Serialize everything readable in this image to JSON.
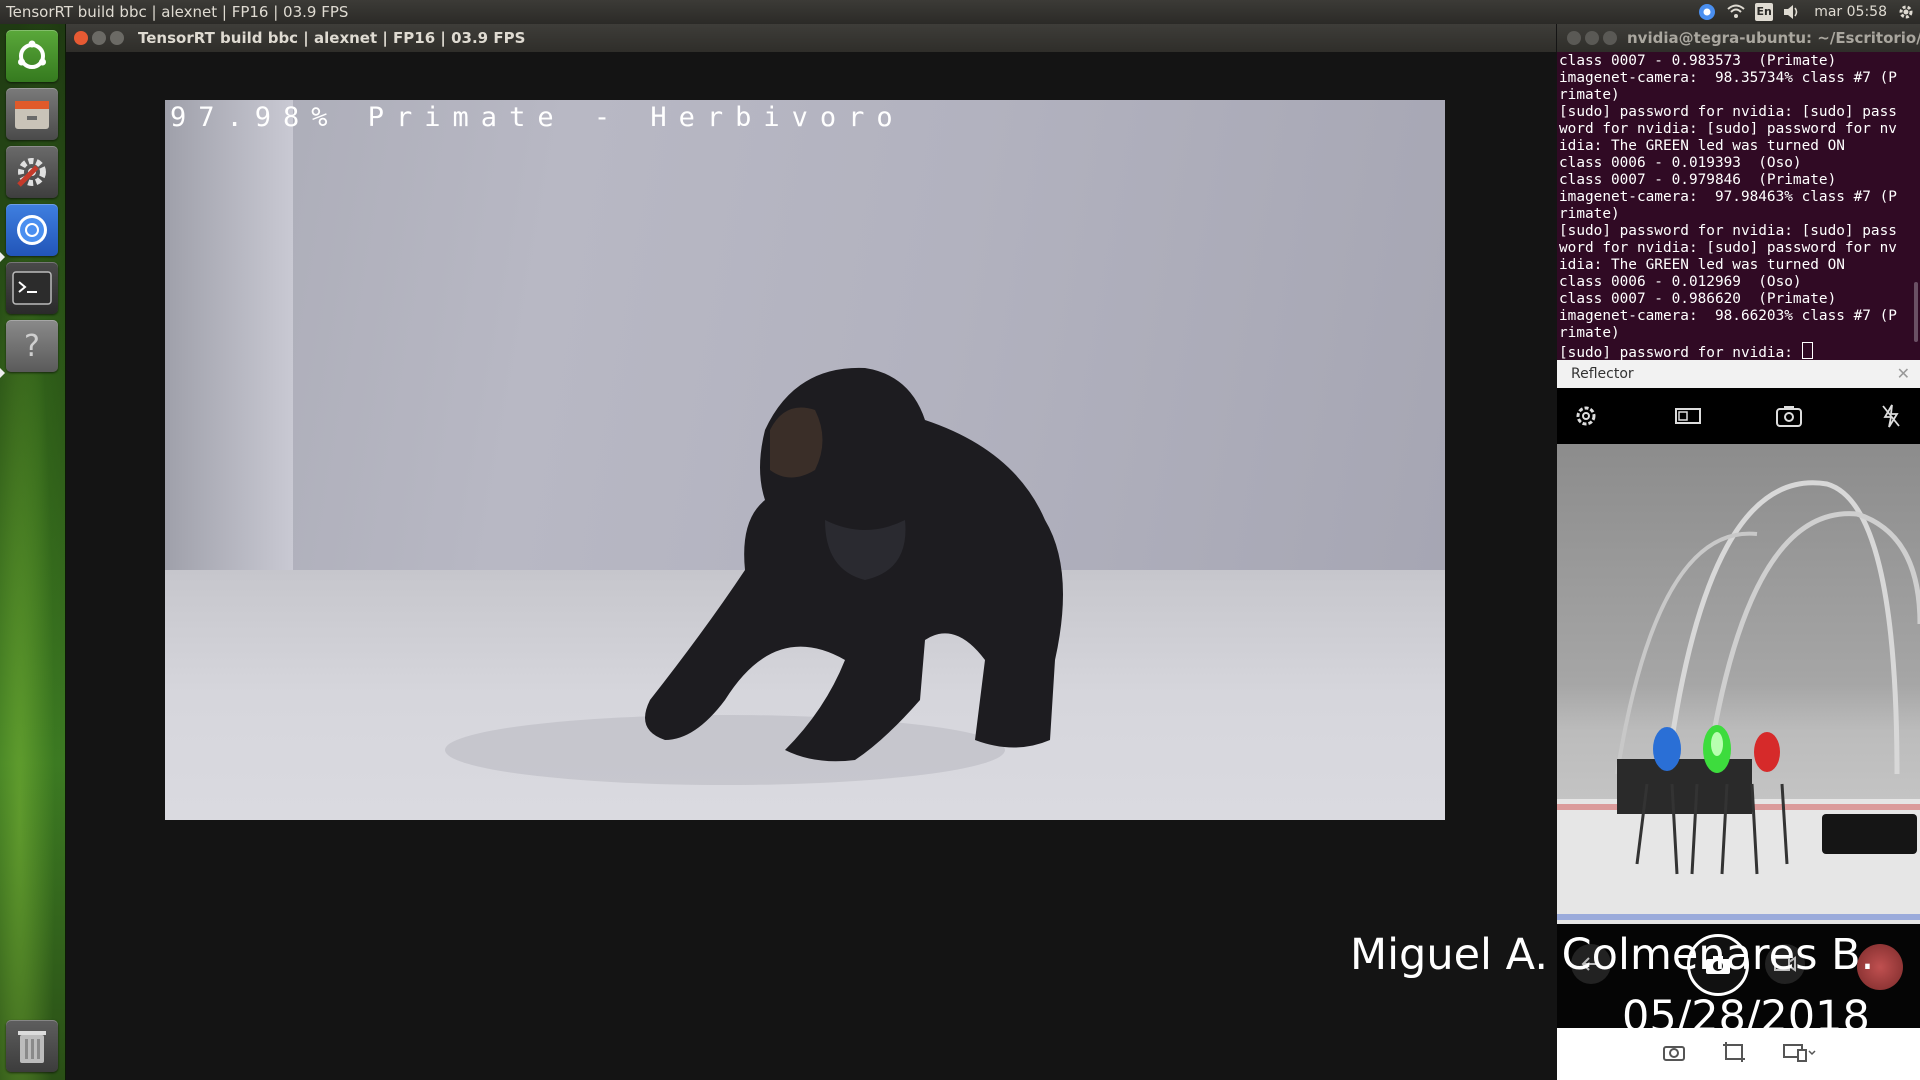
{
  "top_panel": {
    "title": "TensorRT build bbc | alexnet | FP16 | 03.9 FPS",
    "language": "En",
    "clock": "mar 05:58"
  },
  "launcher": {
    "items": [
      {
        "icon": "ubuntu-dash-icon"
      },
      {
        "icon": "file-manager-icon"
      },
      {
        "icon": "system-settings-icon"
      },
      {
        "icon": "chromium-icon"
      },
      {
        "icon": "terminal-icon"
      },
      {
        "icon": "help-icon"
      },
      {
        "icon": "trash-icon"
      }
    ]
  },
  "main_window": {
    "title": "TensorRT build bbc | alexnet | FP16 | 03.9 FPS",
    "overlay_label": "97.98% Primate - Herbivoro"
  },
  "terminal": {
    "title": "nvidia@tegra-ubuntu: ~/Escritorio/jetson",
    "lines": [
      "class 0007 - 0.983573  (Primate)",
      "imagenet-camera:  98.35734% class #7 (P",
      "rimate)",
      "[sudo] password for nvidia: [sudo] pass",
      "word for nvidia: [sudo] password for nv",
      "idia: The GREEN led was turned ON",
      "class 0006 - 0.019393  (Oso)",
      "class 0007 - 0.979846  (Primate)",
      "imagenet-camera:  97.98463% class #7 (P",
      "rimate)",
      "[sudo] password for nvidia: [sudo] pass",
      "word for nvidia: [sudo] password for nv",
      "idia: The GREEN led was turned ON",
      "class 0006 - 0.012969  (Oso)",
      "class 0007 - 0.986620  (Primate)",
      "imagenet-camera:  98.66203% class #7 (P",
      "rimate)"
    ],
    "prompt": "[sudo] password for nvidia: "
  },
  "reflector": {
    "title": "Reflector"
  },
  "credits": {
    "name": "Miguel A. Colmenares B.",
    "date": "05/28/2018"
  },
  "colors": {
    "terminal_bg": "#300a24",
    "led_green": "#3ddc3d",
    "led_blue": "#2a6fd6",
    "led_red": "#d62a2a"
  }
}
